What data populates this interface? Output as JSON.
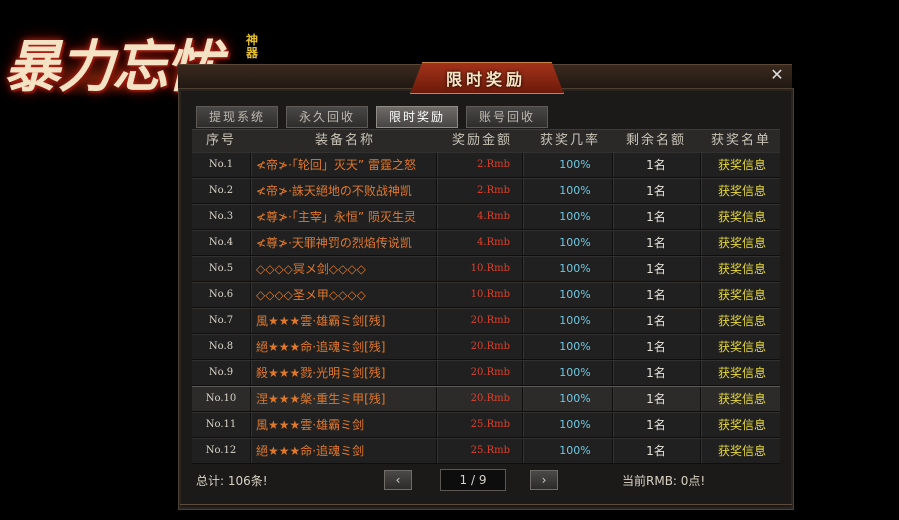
{
  "logo": {
    "text": "暴力忘忧",
    "sub": "神器"
  },
  "window": {
    "title": "限时奖励",
    "close_glyph": "✕"
  },
  "tabs": [
    {
      "label": "提现系统",
      "active": false
    },
    {
      "label": "永久回收",
      "active": false
    },
    {
      "label": "限时奖励",
      "active": true
    },
    {
      "label": "账号回收",
      "active": false
    }
  ],
  "table": {
    "headers": [
      "序号",
      "装备名称",
      "奖励金额",
      "获奖几率",
      "剩余名额",
      "获奖名单"
    ],
    "rows": [
      {
        "no": "No.1",
        "name": "≮帝≯·「轮回」灭天” 雷霆之怒",
        "amount": "2.Rmb",
        "rate": "100%",
        "left": "1名",
        "info": "获奖信息"
      },
      {
        "no": "No.2",
        "name": "≮帝≯·誅天絕地の不败战神凯",
        "amount": "2.Rmb",
        "rate": "100%",
        "left": "1名",
        "info": "获奖信息"
      },
      {
        "no": "No.3",
        "name": "≮尊≯·「主宰」永恒” 陨灭生灵",
        "amount": "4.Rmb",
        "rate": "100%",
        "left": "1名",
        "info": "获奖信息"
      },
      {
        "no": "No.4",
        "name": "≮尊≯·天罪神罚の烈焰传说凯",
        "amount": "4.Rmb",
        "rate": "100%",
        "left": "1名",
        "info": "获奖信息"
      },
      {
        "no": "No.5",
        "name": "◇◇◇◇冥メ剑◇◇◇◇",
        "amount": "10.Rmb",
        "rate": "100%",
        "left": "1名",
        "info": "获奖信息"
      },
      {
        "no": "No.6",
        "name": "◇◇◇◇圣メ甲◇◇◇◇",
        "amount": "10.Rmb",
        "rate": "100%",
        "left": "1名",
        "info": "获奖信息"
      },
      {
        "no": "No.7",
        "name": "風★★★雲·雄霸ミ剑[残]",
        "amount": "20.Rmb",
        "rate": "100%",
        "left": "1名",
        "info": "获奖信息"
      },
      {
        "no": "No.8",
        "name": "絕★★★命·追魂ミ剑[残]",
        "amount": "20.Rmb",
        "rate": "100%",
        "left": "1名",
        "info": "获奖信息"
      },
      {
        "no": "No.9",
        "name": "殺★★★戮·光明ミ剑[残]",
        "amount": "20.Rmb",
        "rate": "100%",
        "left": "1名",
        "info": "获奖信息"
      },
      {
        "no": "No.10",
        "name": "涅★★★槃·重生ミ甲[残]",
        "amount": "20.Rmb",
        "rate": "100%",
        "left": "1名",
        "info": "获奖信息"
      },
      {
        "no": "No.11",
        "name": "風★★★雲·雄霸ミ剑",
        "amount": "25.Rmb",
        "rate": "100%",
        "left": "1名",
        "info": "获奖信息"
      },
      {
        "no": "No.12",
        "name": "絕★★★命·追魂ミ剑",
        "amount": "25.Rmb",
        "rate": "100%",
        "left": "1名",
        "info": "获奖信息"
      }
    ]
  },
  "footer": {
    "total": "总计: 106条!",
    "prev_glyph": "‹",
    "next_glyph": "›",
    "page": "1 / 9",
    "rmb": "当前RMB: 0点!"
  },
  "colors": {
    "name": "#e0782b",
    "amount": "#e0402b",
    "rate": "#6fc8e3",
    "info": "#e6d83a",
    "title_plate": "#a3321a"
  }
}
